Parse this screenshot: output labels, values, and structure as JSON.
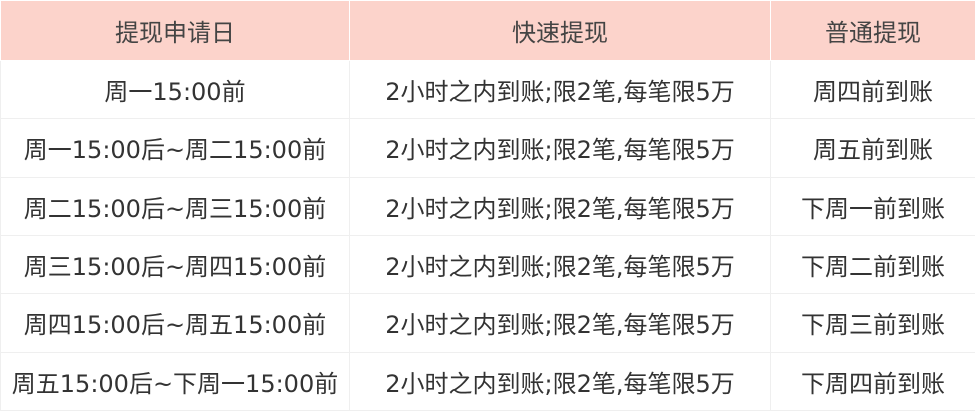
{
  "table": {
    "headers": [
      "提现申请日",
      "快速提现",
      "普通提现"
    ],
    "rows": [
      [
        "周一15:00前",
        "2小时之内到账;限2笔,每笔限5万",
        "周四前到账"
      ],
      [
        "周一15:00后~周二15:00前",
        "2小时之内到账;限2笔,每笔限5万",
        "周五前到账"
      ],
      [
        "周二15:00后~周三15:00前",
        "2小时之内到账;限2笔,每笔限5万",
        "下周一前到账"
      ],
      [
        "周三15:00后~周四15:00前",
        "2小时之内到账;限2笔,每笔限5万",
        "下周二前到账"
      ],
      [
        "周四15:00后~周五15:00前",
        "2小时之内到账;限2笔,每笔限5万",
        "下周三前到账"
      ],
      [
        "周五15:00后~下周一15:00前",
        "2小时之内到账;限2笔,每笔限5万",
        "下周四前到账"
      ]
    ]
  },
  "colors": {
    "header_background": "#fcd3cb",
    "border": "#efefef",
    "text": "#333333"
  }
}
